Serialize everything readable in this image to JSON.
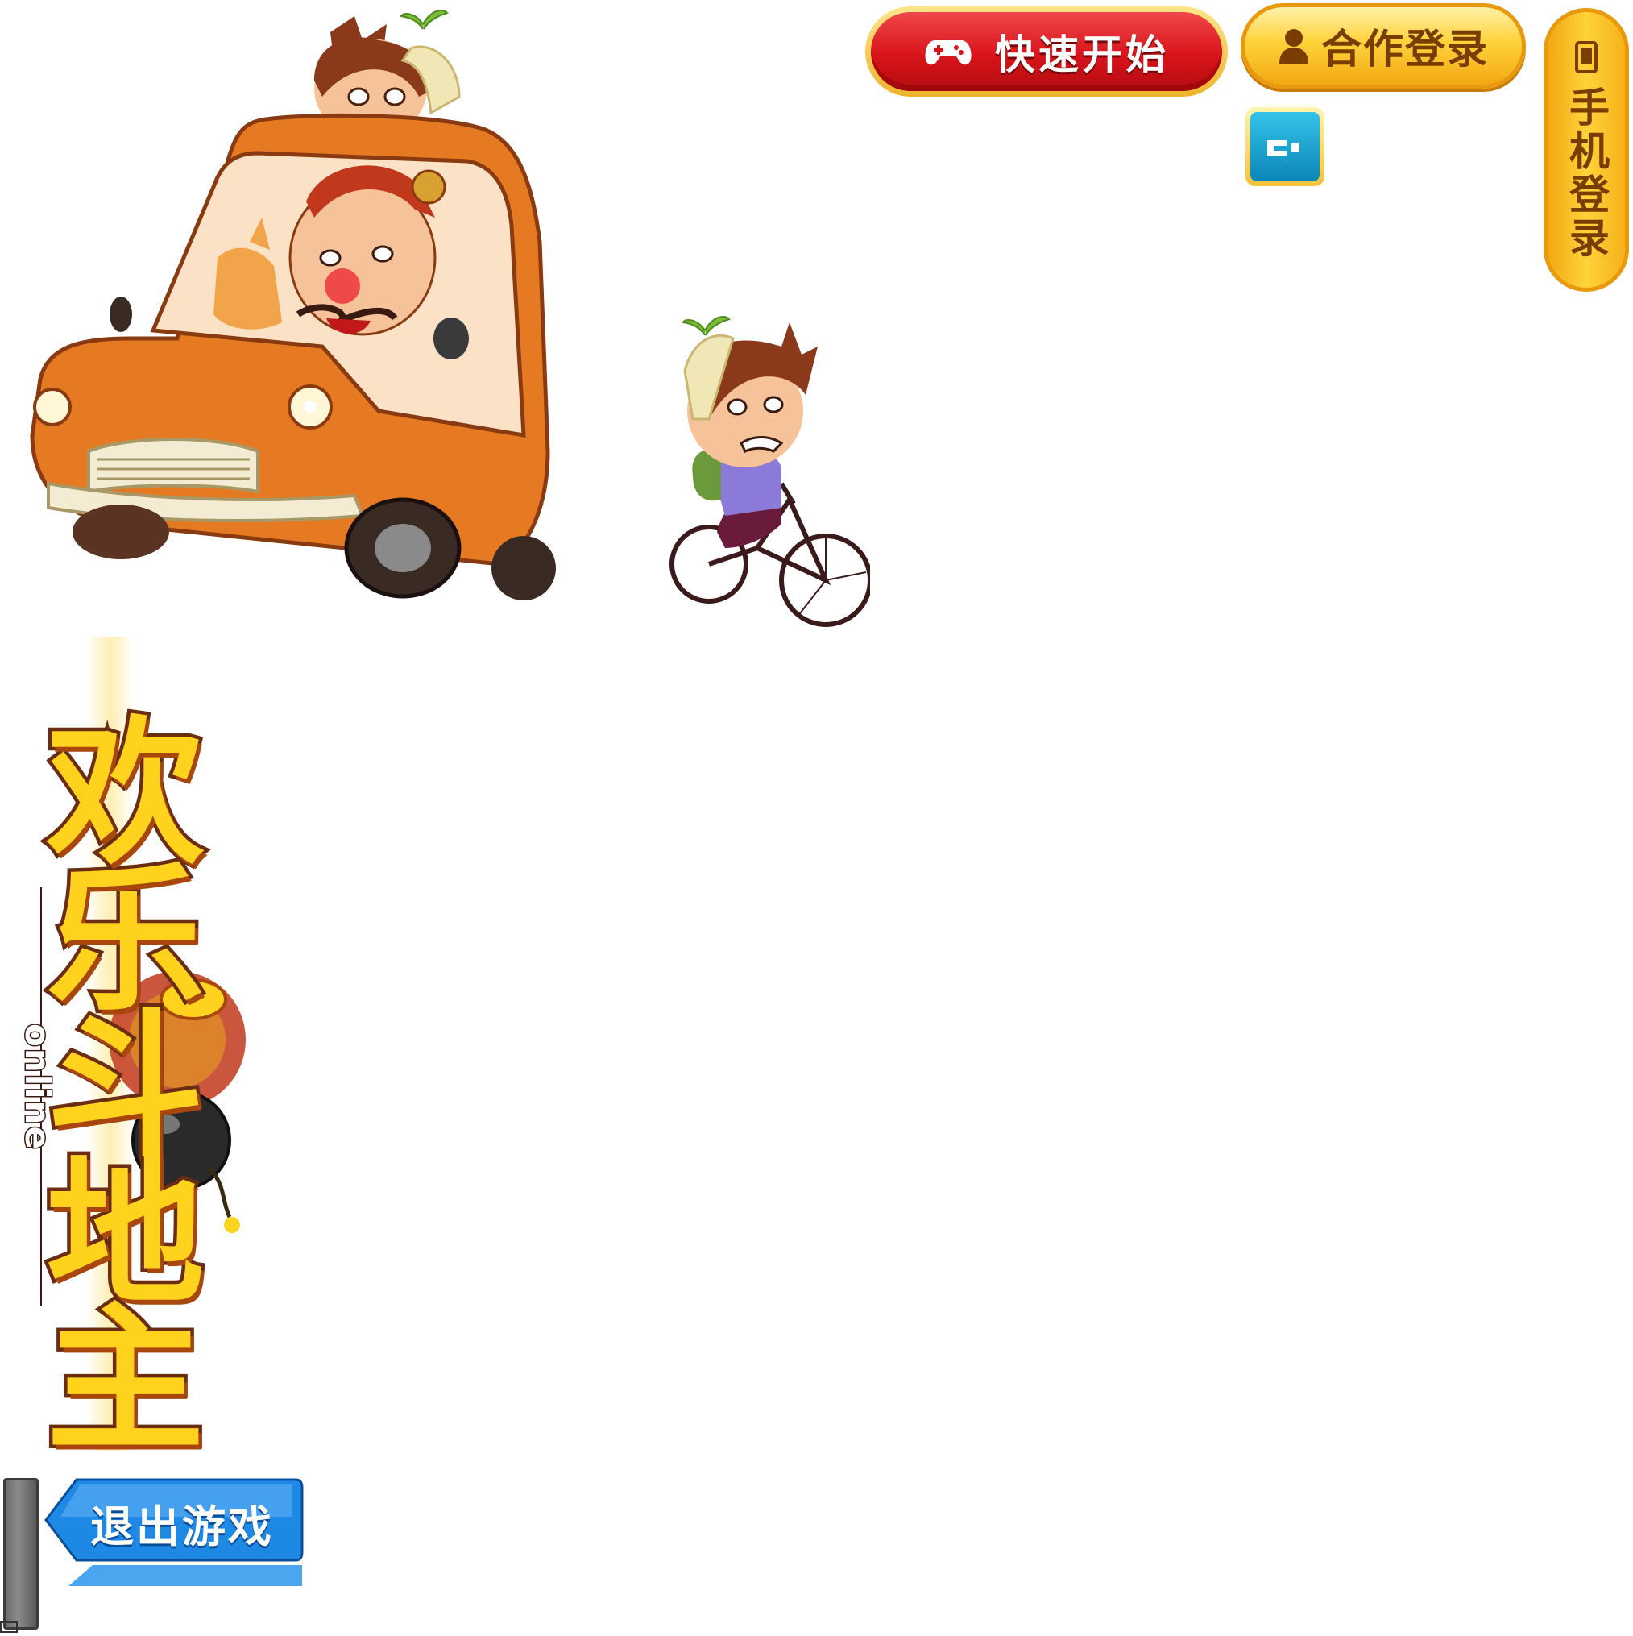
{
  "header": {
    "quick_start_label": "快速开始",
    "partner_login_label": "合作登录",
    "mobile_login_label": "手机登录",
    "info_icon": "info-icon"
  },
  "logo": {
    "title": "欢乐斗地主",
    "subtitle": "online"
  },
  "footer": {
    "exit_label": "退出游戏"
  },
  "colors": {
    "quick_start_red": "#d8141b",
    "partner_gold": "#ffd23a",
    "info_blue": "#0b86b7",
    "exit_blue": "#1e88e5",
    "car_orange": "#e67a22"
  }
}
